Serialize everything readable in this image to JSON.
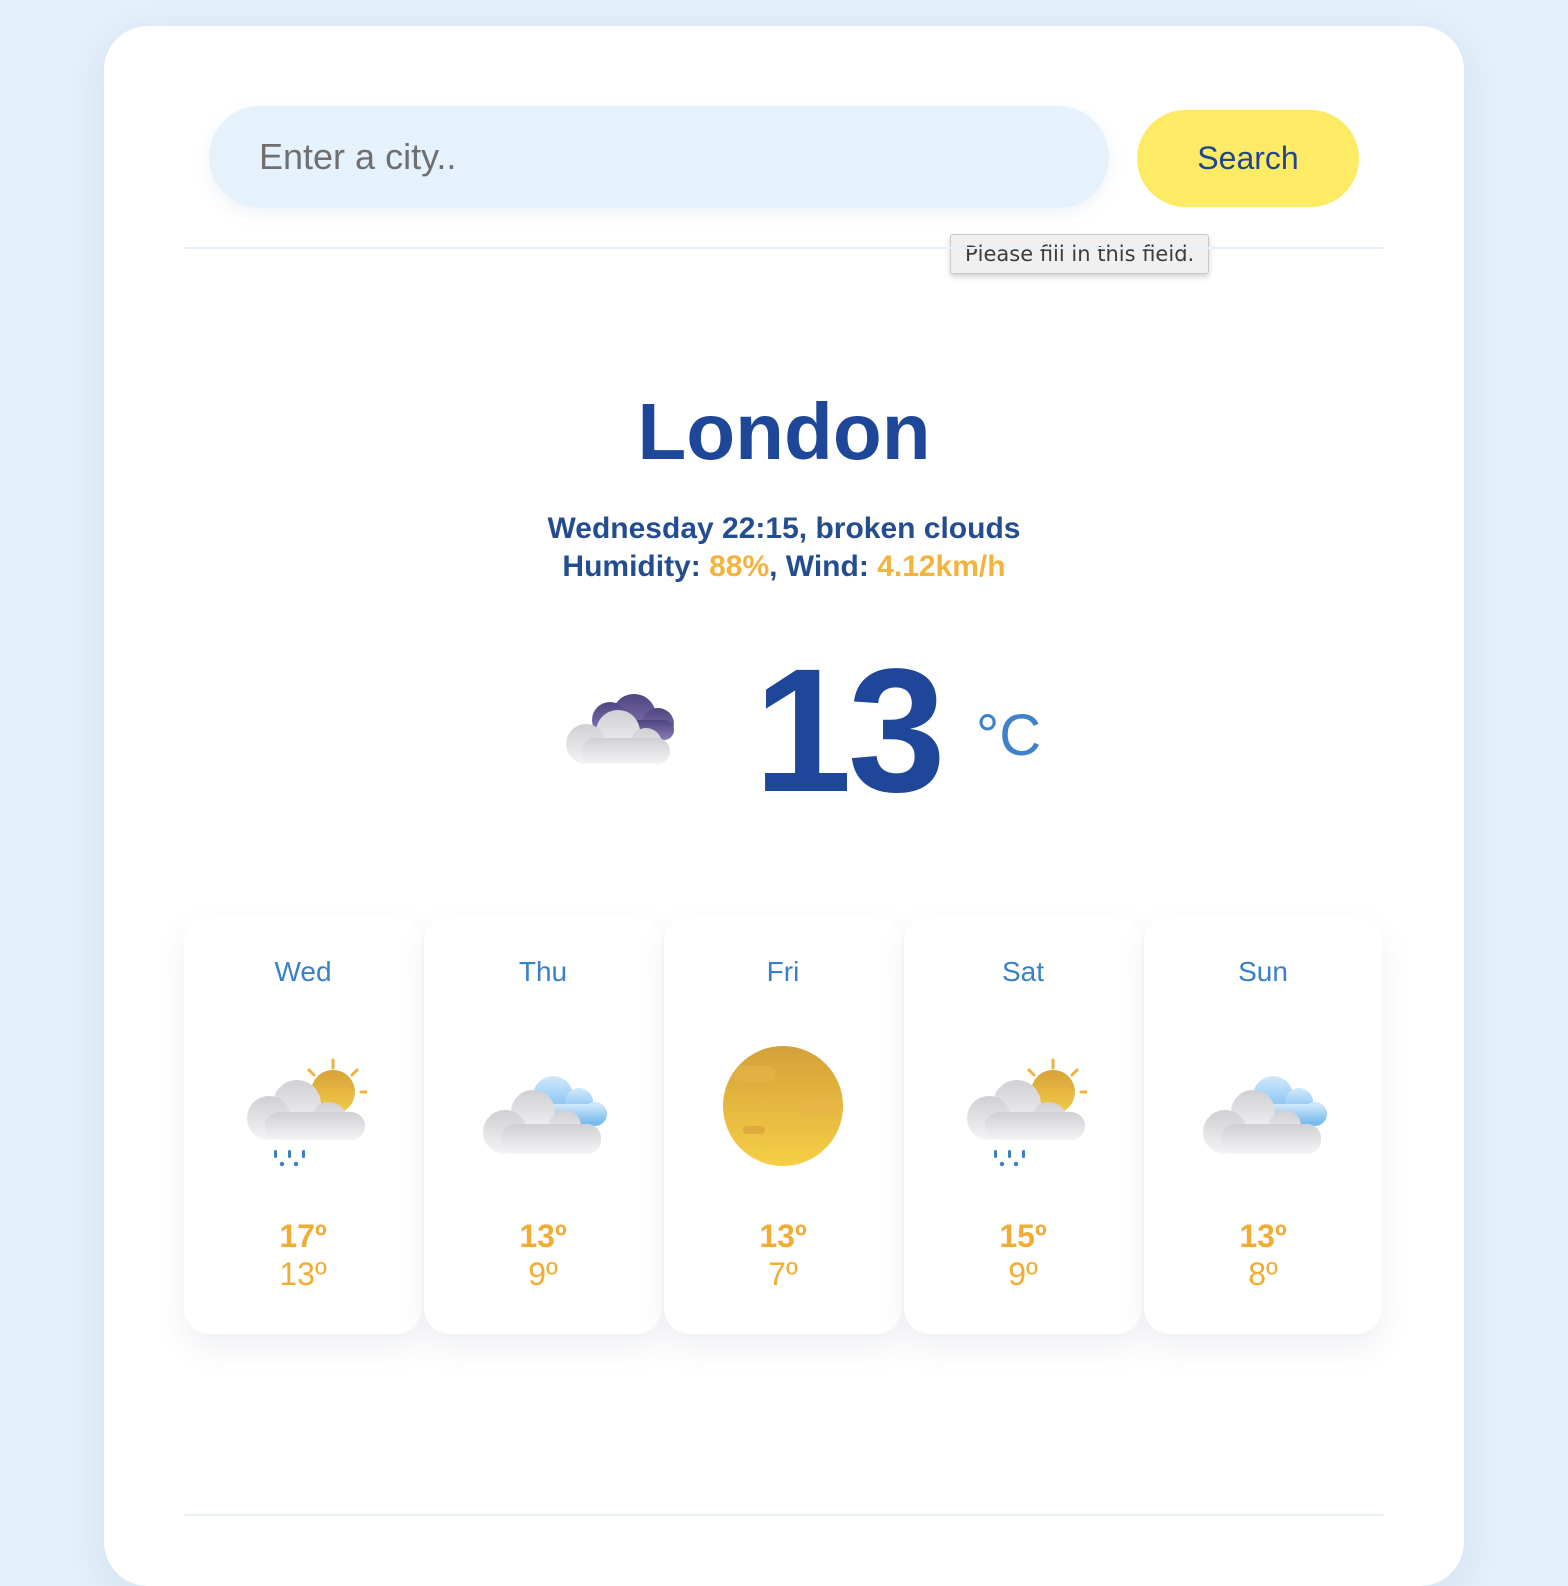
{
  "search": {
    "placeholder": "Enter a city..",
    "value": "",
    "button_label": "Search",
    "validation_tooltip": "Please fill in this field."
  },
  "current": {
    "city": "London",
    "day_time": "Wednesday 22:15",
    "description": "broken clouds",
    "humidity_label": "Humidity:",
    "humidity": "88%",
    "wind_label": "Wind:",
    "wind": "4.12km/h",
    "temperature": "13",
    "unit": "°C",
    "icon": "broken-clouds-icon"
  },
  "colors": {
    "primary": "#1e4699",
    "accent": "#f3b33d",
    "button": "#fdeb65",
    "input_bg": "#e5f2fc",
    "page_bg": "#e4f0fa"
  },
  "forecast": [
    {
      "day": "Wed",
      "max": "17º",
      "min": "13º",
      "icon": "rain-sun-icon"
    },
    {
      "day": "Thu",
      "max": "13º",
      "min": "9º",
      "icon": "clouds-icon"
    },
    {
      "day": "Fri",
      "max": "13º",
      "min": "7º",
      "icon": "sun-icon"
    },
    {
      "day": "Sat",
      "max": "15º",
      "min": "9º",
      "icon": "rain-sun-icon"
    },
    {
      "day": "Sun",
      "max": "13º",
      "min": "8º",
      "icon": "clouds-icon"
    }
  ]
}
